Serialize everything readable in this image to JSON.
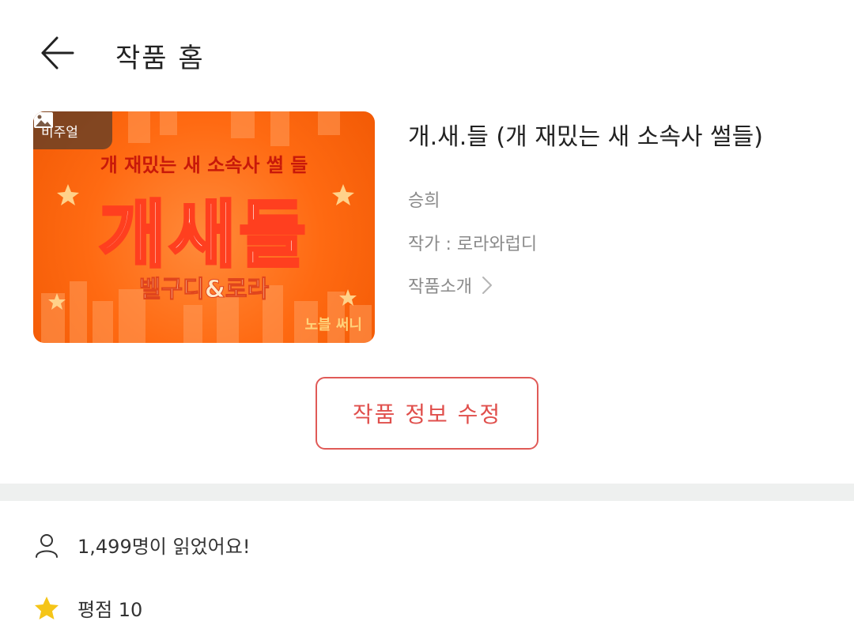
{
  "header": {
    "back_icon": "arrow-left-icon",
    "title": "작품 홈"
  },
  "cover": {
    "badge_icon": "image-icon",
    "badge_label": "비주얼",
    "subtitle": "개 재밌는 새 소속사 썰 들",
    "main_text": "개새들",
    "author_text": "벨구디&로라",
    "corner_text": "노블 써니",
    "colors": {
      "background": "#ff6a12",
      "accent": "#ff3f1f"
    }
  },
  "work": {
    "title": "개.새.들 (개 재밌는 새 소속사 썰들)",
    "genre": "승희",
    "author": "작가 : 로라와럽디",
    "intro_label": "작품소개",
    "intro_icon": "chevron-right-icon"
  },
  "actions": {
    "edit_label": "작품 정보 수정",
    "edit_color": "#e05a57"
  },
  "stats": {
    "readers_icon": "person-icon",
    "readers_text": "1,499명이 읽었어요!",
    "rating_icon": "star-icon",
    "rating_text": "평점 10",
    "star_color": "#f5c518"
  }
}
